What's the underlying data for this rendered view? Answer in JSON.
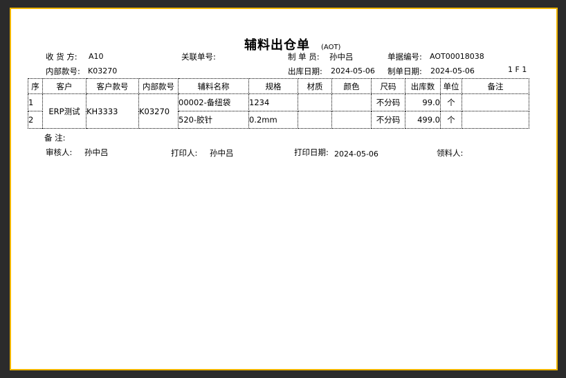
{
  "doc": {
    "title": "辅料出仓单",
    "subtitle": "(AOT)",
    "page_indicator": "1 F 1"
  },
  "header": {
    "receiver_label": "收  货  方:",
    "receiver_value": "A10",
    "related_no_label": "关联单号:",
    "creator_label": "制  单  员:",
    "creator_value": "孙中吕",
    "doc_no_label": "单据编号:",
    "doc_no_value": "AOT00018038",
    "internal_style_label": "内部款号:",
    "internal_style_value": "K03270",
    "out_date_label": "出库日期:",
    "out_date_value": "2024-05-06",
    "create_date_label": "制单日期:",
    "create_date_value": "2024-05-06"
  },
  "table": {
    "headers": [
      "序",
      "客户",
      "客户款号",
      "内部款号",
      "辅料名称",
      "规格",
      "材质",
      "颜色",
      "尺码",
      "出库数",
      "单位",
      "备注"
    ],
    "group": {
      "customer": "ERP测试",
      "customer_style": "KH3333",
      "internal_style": "K03270"
    },
    "rows": [
      {
        "seq": "1",
        "material": "00002-备纽袋",
        "spec": "1234",
        "texture": "",
        "color": "",
        "size": "不分码",
        "qty": "99.0",
        "unit": "个",
        "remark": ""
      },
      {
        "seq": "2",
        "material": "520-胶针",
        "spec": "0.2mm",
        "texture": "",
        "color": "",
        "size": "不分码",
        "qty": "499.0",
        "unit": "个",
        "remark": ""
      }
    ]
  },
  "footer": {
    "remarks_label": "备    注:",
    "reviewer_label": "审核人:",
    "reviewer_value": "孙中吕",
    "printer_label": "打印人:",
    "printer_value": "孙中吕",
    "print_date_label": "打印日期:",
    "print_date_value": "2024-05-06",
    "receiver_label": "领料人:"
  }
}
